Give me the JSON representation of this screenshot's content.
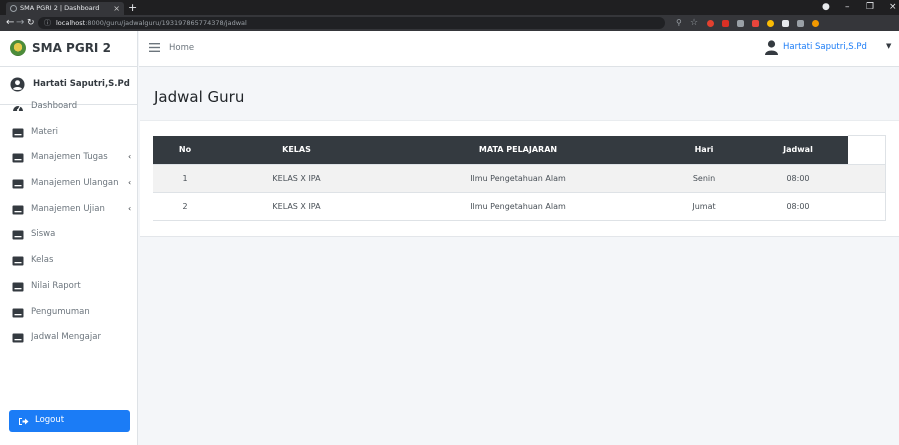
{
  "browser": {
    "tab_title": "SMA PGRI 2 | Dashboard",
    "tab_close": "×",
    "new_tab": "+",
    "url_host": "localhost",
    "url_rest": ":8000/guru/jadwalguru/193197865774378/jadwal"
  },
  "sidebar": {
    "brand": "SMA PGRI 2",
    "user_name": "Hartati Saputri,S.Pd",
    "items": [
      {
        "label": "Dashboard",
        "icon": "tachometer-icon",
        "submenu": false
      },
      {
        "label": "Materi",
        "icon": "book-icon",
        "submenu": false
      },
      {
        "label": "Manajemen Tugas",
        "icon": "book-icon",
        "submenu": true
      },
      {
        "label": "Manajemen Ulangan",
        "icon": "book-icon",
        "submenu": true
      },
      {
        "label": "Manajemen Ujian",
        "icon": "book-icon",
        "submenu": true
      },
      {
        "label": "Siswa",
        "icon": "book-icon",
        "submenu": false
      },
      {
        "label": "Kelas",
        "icon": "book-icon",
        "submenu": false
      },
      {
        "label": "Nilai Raport",
        "icon": "book-icon",
        "submenu": false
      },
      {
        "label": "Pengumuman",
        "icon": "book-icon",
        "submenu": false
      },
      {
        "label": "Jadwal Mengajar",
        "icon": "book-icon",
        "submenu": false
      }
    ],
    "caret": "‹",
    "logout_label": "Logout"
  },
  "topnav": {
    "home_label": "Home",
    "user_name": "Hartati Saputri,S.Pd",
    "caret": "▼"
  },
  "main": {
    "page_title": "Jadwal Guru",
    "table": {
      "headers": [
        "No",
        "KELAS",
        "MATA PELAJARAN",
        "Hari",
        "Jadwal"
      ],
      "rows": [
        [
          "1",
          "KELAS X IPA",
          "Ilmu Pengetahuan Alam",
          "Senin",
          "08:00"
        ],
        [
          "2",
          "KELAS X IPA",
          "Ilmu Pengetahuan Alam",
          "Jumat",
          "08:00"
        ]
      ]
    }
  },
  "colors": {
    "accent": "#1b7cf6",
    "table_header": "#343a40",
    "sidebar_bg": "#ffffff",
    "content_bg": "#f4f6f9"
  }
}
